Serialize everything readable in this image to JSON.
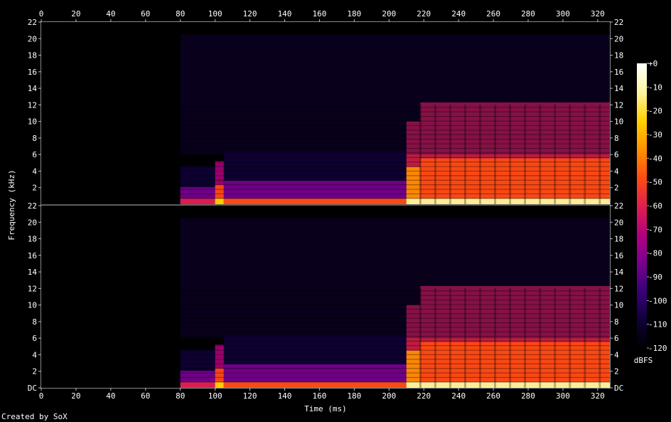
{
  "chart_data": {
    "type": "heatmap",
    "title": "",
    "xlabel": "Time (ms)",
    "ylabel": "Frequency (kHz)",
    "x_ticks": [
      "0",
      "20",
      "40",
      "60",
      "80",
      "100",
      "120",
      "140",
      "160",
      "180",
      "200",
      "220",
      "240",
      "260",
      "280",
      "300",
      "320"
    ],
    "xlim": [
      0,
      327
    ],
    "channels": [
      {
        "y_ticks": [
          "22",
          "20",
          "18",
          "16",
          "14",
          "12",
          "10",
          "8",
          "6",
          "4",
          "2"
        ],
        "ylim": [
          0,
          22
        ]
      },
      {
        "y_ticks": [
          "22",
          "20",
          "18",
          "16",
          "14",
          "12",
          "10",
          "8",
          "6",
          "4",
          "2",
          "DC"
        ],
        "ylim": [
          0,
          22
        ]
      }
    ],
    "colorbar": {
      "label": "dBFS",
      "ticks": [
        "+0",
        "-10",
        "-20",
        "-30",
        "-40",
        "-50",
        "-60",
        "-70",
        "-80",
        "-90",
        "-100",
        "-110",
        "-120"
      ],
      "range": [
        -120,
        0
      ],
      "colormap": [
        "#000000",
        "#10003a",
        "#3a007a",
        "#7a0090",
        "#b4007e",
        "#e0204c",
        "#ff4e10",
        "#ff9400",
        "#ffd200",
        "#fff6a0",
        "#ffffff"
      ]
    },
    "segments": [
      {
        "start_ms": 80,
        "end_ms": 100,
        "band_top_khz": 4.6,
        "level_db": -95
      },
      {
        "start_ms": 100,
        "end_ms": 105,
        "band_top_khz": 5.2,
        "level_db": -55
      },
      {
        "start_ms": 105,
        "end_ms": 210,
        "band_top_khz": 6.3,
        "level_db": -88
      },
      {
        "start_ms": 210,
        "end_ms": 218,
        "band_top_khz": 10.0,
        "level_db": -45
      },
      {
        "start_ms": 218,
        "end_ms": 327,
        "band_top_khz": 12.3,
        "level_db": -50
      }
    ],
    "grid": false,
    "legend": "right"
  },
  "footer": {
    "credit": "Created by SoX"
  }
}
